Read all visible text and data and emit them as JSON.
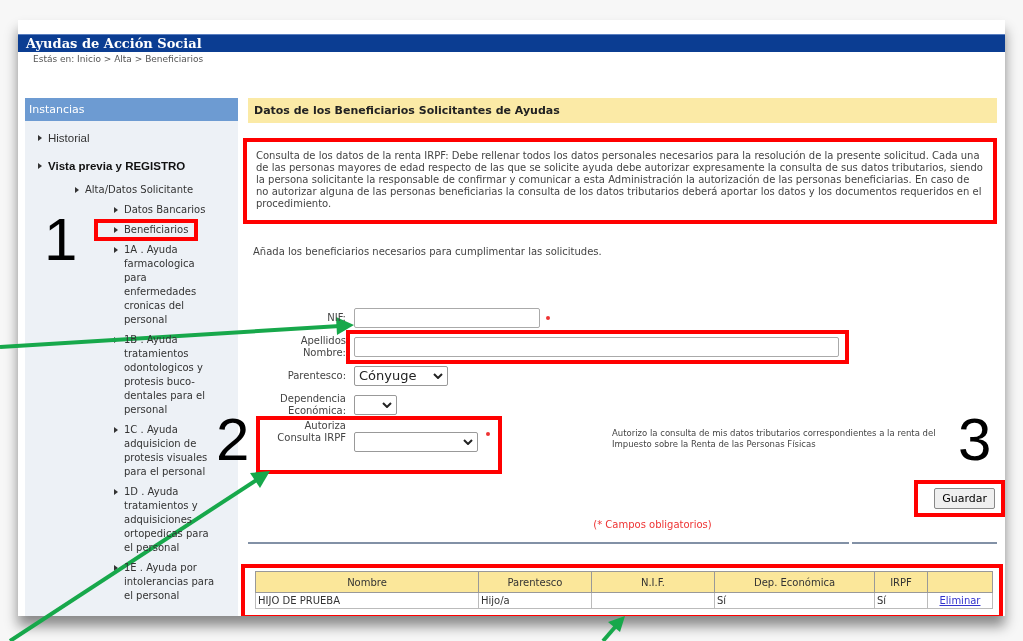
{
  "header": {
    "title": "Ayudas de Acción Social",
    "breadcrumb": "Estás en: Inicio > Alta > Beneficiarios"
  },
  "sidebar": {
    "title": "Instancias",
    "items": [
      {
        "label": "Historial",
        "emphasized": false,
        "highlighted": false
      },
      {
        "label": "Vista previa y REGISTRO",
        "emphasized": true,
        "highlighted": false,
        "children": [
          {
            "label": "Alta/Datos Solicitante",
            "emphasized": false,
            "highlighted": false,
            "children": [
              {
                "label": "Datos Bancarios",
                "emphasized": false,
                "highlighted": false
              },
              {
                "label": "Beneficiarios",
                "emphasized": false,
                "highlighted": true
              },
              {
                "label": "1A . Ayuda farmacologica para enfermedades cronicas del personal",
                "emphasized": false,
                "highlighted": false
              },
              {
                "label": "1B . Ayuda tratamientos odontologicos y protesis buco-dentales para el personal",
                "emphasized": false,
                "highlighted": false
              },
              {
                "label": "1C . Ayuda adquisicion de protesis visuales para el personal",
                "emphasized": false,
                "highlighted": false
              },
              {
                "label": "1D . Ayuda tratamientos y adquisiciones ortopedicas para el personal",
                "emphasized": false,
                "highlighted": false
              },
              {
                "label": "1E . Ayuda por intolerancias para el personal",
                "emphasized": false,
                "highlighted": false
              }
            ]
          }
        ]
      }
    ]
  },
  "main": {
    "section_title": "Datos de los Beneficiarios Solicitantes de Ayudas",
    "notice": {
      "text": "Consulta de los datos de la renta IRPF: Debe rellenar todos los datos personales necesarios para la resolución de la presente solicitud. Cada una de las personas mayores de edad respecto de las que se solicite ayuda debe autorizar expresamente la consulta de sus datos tributarios, siendo la persona solicitante la responsable de confirmar y comunicar a esta Administración la autorización de las personas beneficiarias. En caso de no autorizar alguna de las personas beneficiarias la consulta de los datos tributarios deberá aportar los datos y los documentos requeridos en el procedimiento.",
      "highlighted": true
    },
    "intro": "Añada los beneficiarios necesarios para cumplimentar las solicitudes.",
    "fields": [
      {
        "kind": "text",
        "label": "NIF:",
        "required": true,
        "highlighted": false
      },
      {
        "kind": "text",
        "label": "Apellidos Nombre:",
        "required": false,
        "highlighted": true
      },
      {
        "kind": "select",
        "label": "Parentesco:",
        "value": "Cónyuge",
        "required": false,
        "highlighted": false
      },
      {
        "kind": "select",
        "label": "Dependencia Económica:",
        "required": false,
        "highlighted": false
      },
      {
        "kind": "select",
        "label": "Autoriza Consulta IRPF",
        "required": true,
        "highlighted": true,
        "note": "Autorizo la consulta de mis datos tributarios correspondientes a la renta del Impuesto sobre la Renta de las Personas Físicas"
      }
    ],
    "save_button": {
      "label": "Guardar",
      "highlighted": true
    },
    "required_note": "(* Campos obligatorios)",
    "table": {
      "highlighted": true,
      "columns": [
        "Nombre",
        "Parentesco",
        "N.I.F.",
        "Dep. Económica",
        "IRPF"
      ],
      "rows": [
        {
          "cells": [
            "HIJO DE PRUEBA",
            "Hijo/a",
            null,
            "Sí",
            "Sí"
          ],
          "action": "Eliminar"
        }
      ]
    }
  },
  "annotations": [
    {
      "number": "1"
    },
    {
      "number": "2"
    },
    {
      "number": "3"
    }
  ]
}
